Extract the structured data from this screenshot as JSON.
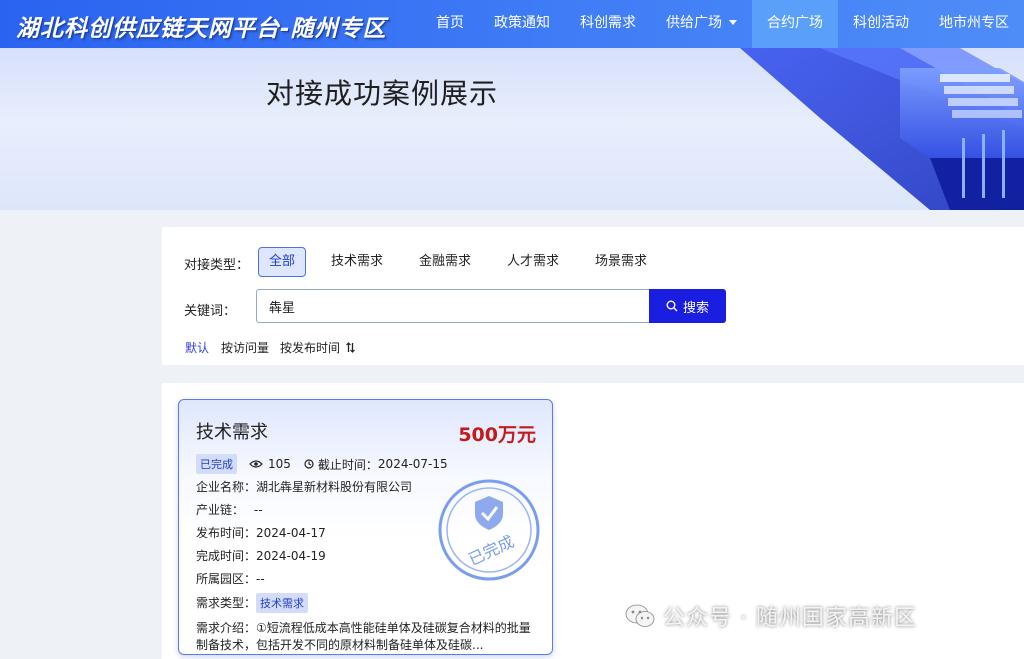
{
  "header": {
    "site_title": "湖北科创供应链天网平台-随州专区",
    "nav": [
      {
        "label": "首页"
      },
      {
        "label": "政策通知"
      },
      {
        "label": "科创需求"
      },
      {
        "label": "供给广场"
      },
      {
        "label": "合约广场"
      },
      {
        "label": "科创活动"
      },
      {
        "label": "地市州专区"
      }
    ],
    "active_nav": "合约广场"
  },
  "banner": {
    "title": "对接成功案例展示"
  },
  "filters": {
    "type_label": "对接类型：",
    "types": [
      "全部",
      "技术需求",
      "金融需求",
      "人才需求",
      "场景需求"
    ],
    "active_type": "全部",
    "keyword_label": "关键词：",
    "keyword_value": "犇星",
    "search_button": "搜索",
    "sort_options": [
      "默认",
      "按访问量",
      "按发布时间"
    ],
    "active_sort": "默认"
  },
  "cards": [
    {
      "type": "技术需求",
      "amount": "500万元",
      "status": "已完成",
      "views": "105",
      "deadline_label": "截止时间：",
      "deadline": "2024-07-15",
      "company_label": "企业名称：",
      "company": "湖北犇星新材料股份有限公司",
      "chain_label": "产业链：",
      "chain": "--",
      "publish_label": "发布时间：",
      "publish_date": "2024-04-17",
      "complete_label": "完成时间：",
      "complete_date": "2024-04-19",
      "park_label": "所属园区：",
      "park": "--",
      "demand_type_label": "需求类型：",
      "demand_type": "技术需求",
      "intro_label": "需求介绍：",
      "intro": "①短流程低成本高性能硅单体及硅碳复合材料的批量制备技术，包括开发不同的原材料制备硅单体及硅碳...",
      "stamp_text": "已完成"
    }
  ],
  "watermark": {
    "text": "公众号 · 随州国家高新区"
  },
  "colors": {
    "primary": "#2a63f0",
    "button": "#1a1ee0",
    "price": "#c41a1a",
    "badge_bg": "#d3ddfa"
  }
}
